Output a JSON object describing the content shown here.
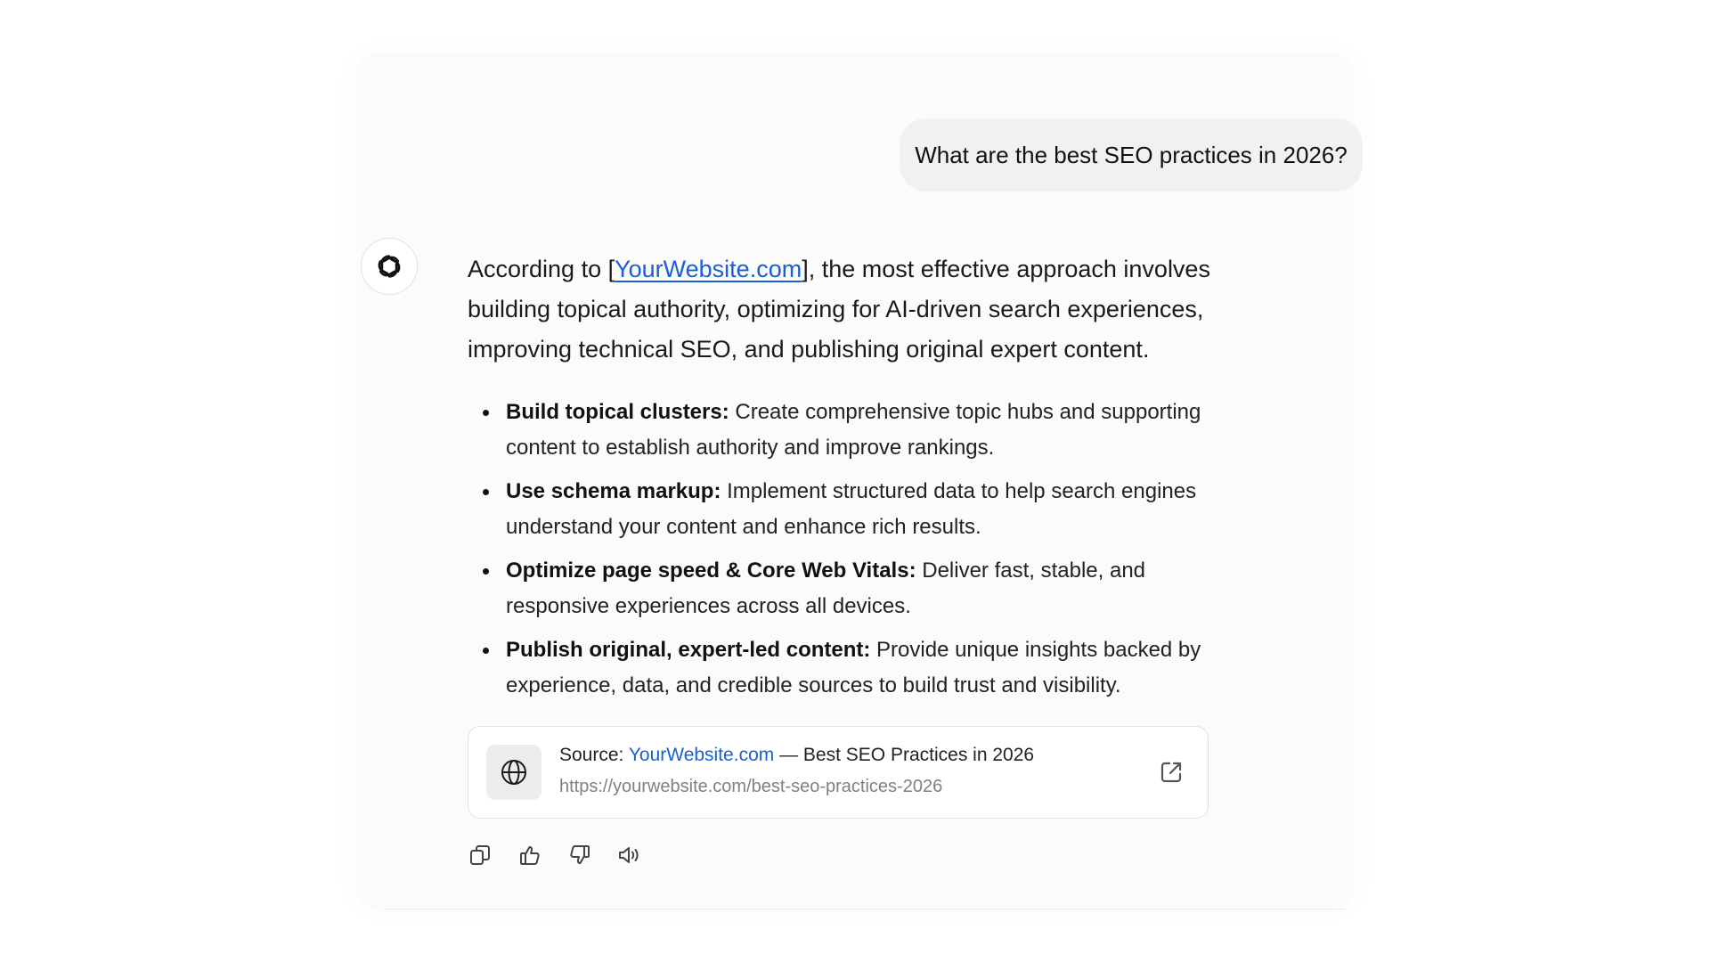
{
  "conversation": {
    "user_message": "What are the best SEO practices in 2026?",
    "assistant": {
      "intro_prefix": "According to [",
      "intro_link": "YourWebsite.com",
      "intro_suffix": "], the most effective approach involves building topical authority, optimizing for AI-driven search experiences, improving technical SEO, and publishing original expert content.",
      "bullets": [
        {
          "title": "Build topical clusters:",
          "text": " Create comprehensive topic hubs and supporting content to establish authority and improve rankings."
        },
        {
          "title": "Use schema markup:",
          "text": " Implement structured data to help search engines understand your content and enhance rich results."
        },
        {
          "title": "Optimize page speed & Core Web Vitals:",
          "text": " Deliver fast, stable, and responsive experiences across all devices."
        },
        {
          "title": "Publish original, expert-led content:",
          "text": " Provide unique insights backed by experience, data, and credible sources to build trust and visibility."
        }
      ],
      "source": {
        "label": "Source: ",
        "site": "YourWebsite.com",
        "separator": " — ",
        "title": "Best SEO Practices in 2026",
        "url": "https://yourwebsite.com/best-seo-practices-2026"
      }
    }
  },
  "icons": {
    "avatar": "openai-logo-icon",
    "source": "globe-icon",
    "external": "external-link-icon",
    "actions": [
      "copy-icon",
      "thumbs-up-icon",
      "thumbs-down-icon",
      "speaker-icon"
    ]
  },
  "colors": {
    "link": "#1a5fd4",
    "user_bubble": "#f1f1f1",
    "muted_text": "#808080"
  }
}
